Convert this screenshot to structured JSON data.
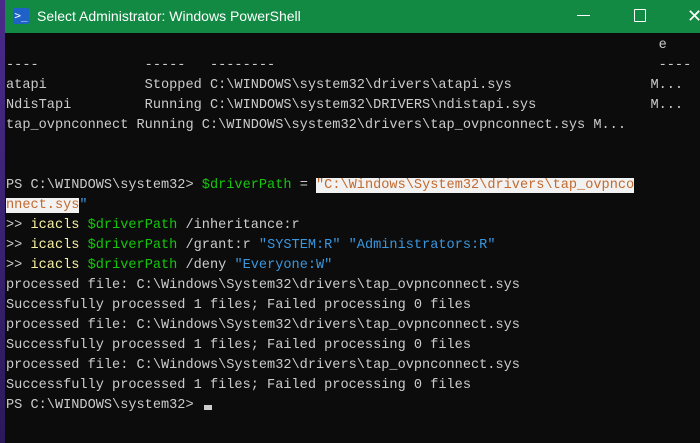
{
  "window": {
    "title": "Select Administrator: Windows PowerShell",
    "icon": "powershell-icon",
    "close_glyph": "✕"
  },
  "colors": {
    "titlebar": "#128a43",
    "background": "#0c0c0c",
    "text": "#cccccc",
    "command": "#f9f1a5",
    "variable": "#16c60c",
    "string": "#3a96dd"
  },
  "lines": [
    [
      {
        "t": "                                                                                e",
        "c": "text"
      }
    ],
    [
      {
        "t": "----             -----   --------                                               ----",
        "c": "text"
      }
    ],
    [
      {
        "t": "atapi            Stopped C:\\WINDOWS\\system32\\drivers\\atapi.sys                 M...",
        "c": "text"
      }
    ],
    [
      {
        "t": "NdisTapi         Running C:\\WINDOWS\\system32\\DRIVERS\\ndistapi.sys              M...",
        "c": "text"
      }
    ],
    [
      {
        "t": "tap_ovpnconnect Running C:\\WINDOWS\\system32\\drivers\\tap_ovpnconnect.sys M...",
        "c": "text"
      }
    ],
    [
      {
        "t": " ",
        "c": "text"
      }
    ],
    [
      {
        "t": " ",
        "c": "text"
      }
    ],
    [
      {
        "t": "PS C:\\WINDOWS\\system32> ",
        "c": "text"
      },
      {
        "t": "$driverPath",
        "c": "var"
      },
      {
        "t": " = ",
        "c": "text"
      },
      {
        "t": "\"C:\\Windows\\System32\\drivers\\tap_ovpnco",
        "c": "sel"
      }
    ],
    [
      {
        "t": "nnect.sys",
        "c": "sel"
      },
      {
        "t": "\"",
        "c": "str"
      }
    ],
    [
      {
        "t": ">> ",
        "c": "text"
      },
      {
        "t": "icacls ",
        "c": "cmd"
      },
      {
        "t": "$driverPath",
        "c": "var"
      },
      {
        "t": " /inheritance:r",
        "c": "text"
      }
    ],
    [
      {
        "t": ">> ",
        "c": "text"
      },
      {
        "t": "icacls ",
        "c": "cmd"
      },
      {
        "t": "$driverPath",
        "c": "var"
      },
      {
        "t": " /grant:r ",
        "c": "text"
      },
      {
        "t": "\"SYSTEM:R\" \"Administrators:R\"",
        "c": "str"
      }
    ],
    [
      {
        "t": ">> ",
        "c": "text"
      },
      {
        "t": "icacls ",
        "c": "cmd"
      },
      {
        "t": "$driverPath",
        "c": "var"
      },
      {
        "t": " /deny ",
        "c": "text"
      },
      {
        "t": "\"Everyone:W\"",
        "c": "str"
      }
    ],
    [
      {
        "t": "processed file: C:\\Windows\\System32\\drivers\\tap_ovpnconnect.sys",
        "c": "text"
      }
    ],
    [
      {
        "t": "Successfully processed 1 files; Failed processing 0 files",
        "c": "text"
      }
    ],
    [
      {
        "t": "processed file: C:\\Windows\\System32\\drivers\\tap_ovpnconnect.sys",
        "c": "text"
      }
    ],
    [
      {
        "t": "Successfully processed 1 files; Failed processing 0 files",
        "c": "text"
      }
    ],
    [
      {
        "t": "processed file: C:\\Windows\\System32\\drivers\\tap_ovpnconnect.sys",
        "c": "text"
      }
    ],
    [
      {
        "t": "Successfully processed 1 files; Failed processing 0 files",
        "c": "text"
      }
    ],
    [
      {
        "t": "PS C:\\WINDOWS\\system32> ",
        "c": "text"
      }
    ]
  ]
}
